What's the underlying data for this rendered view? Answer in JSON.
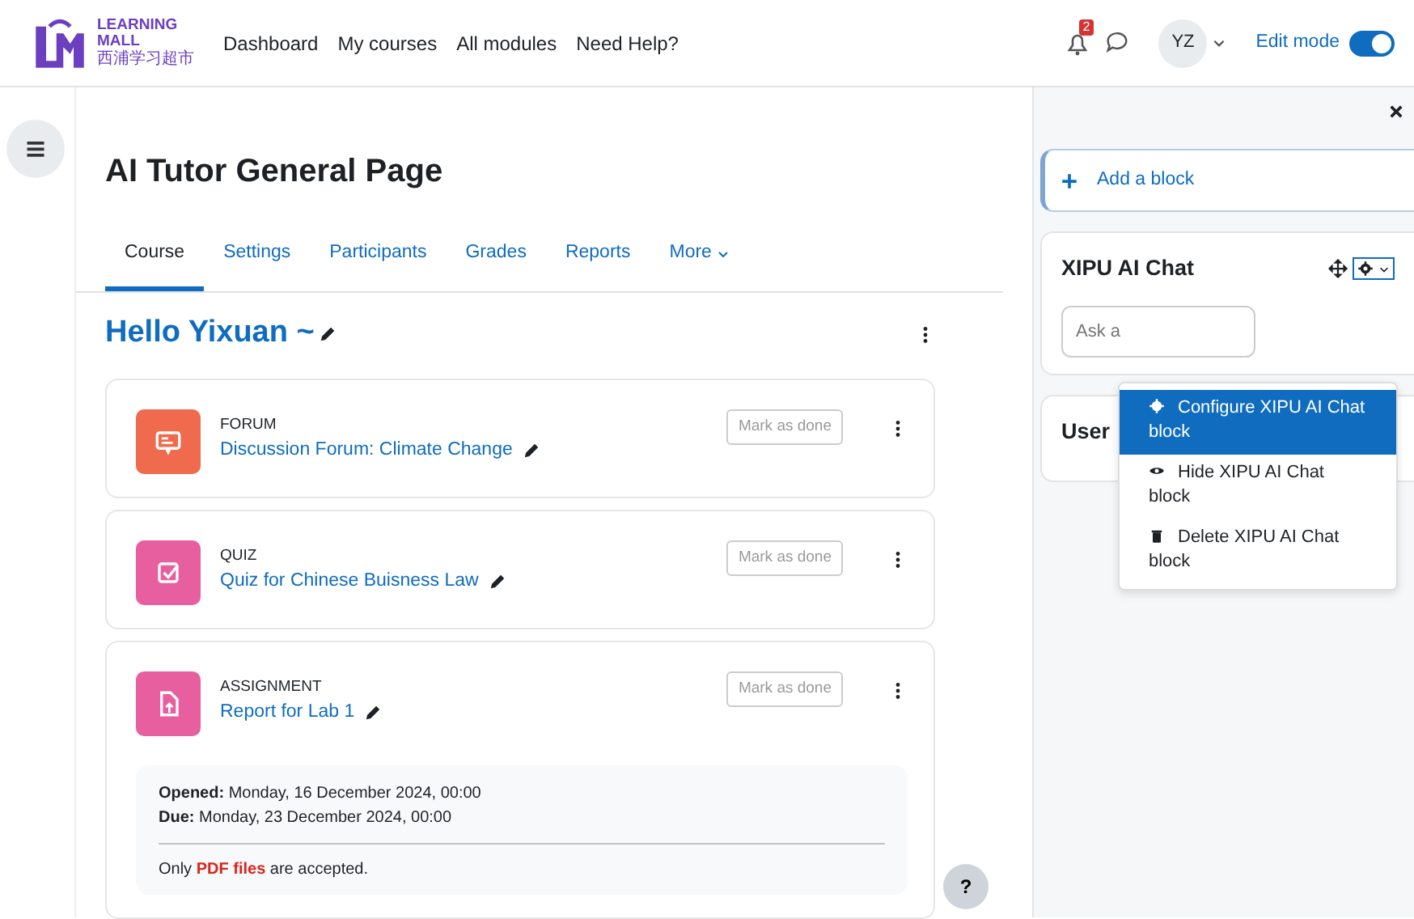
{
  "logo": {
    "lines": [
      "LEARNING",
      "MALL",
      "西浦学习超市"
    ]
  },
  "nav": [
    {
      "label": "Dashboard"
    },
    {
      "label": "My courses"
    },
    {
      "label": "All modules"
    },
    {
      "label": "Need Help?"
    }
  ],
  "notifications": {
    "count": "2"
  },
  "user": {
    "initials": "YZ"
  },
  "edit_mode": {
    "label": "Edit mode",
    "on": true
  },
  "page_title": "AI Tutor General Page",
  "tabs": [
    {
      "label": "Course",
      "selected": true
    },
    {
      "label": "Settings",
      "selected": false
    },
    {
      "label": "Participants",
      "selected": false
    },
    {
      "label": "Grades",
      "selected": false
    },
    {
      "label": "Reports",
      "selected": false
    },
    {
      "label": "More",
      "selected": false,
      "dropdown": true
    }
  ],
  "section_title": "Hello Yixuan ~",
  "activities": [
    {
      "kind": "forum",
      "type_label": "FORUM",
      "name": "Discussion Forum: Climate Change",
      "button": {
        "label": "Mark as done",
        "disabled": true
      }
    },
    {
      "kind": "quiz",
      "type_label": "QUIZ",
      "name": "Quiz for Chinese Buisness Law",
      "button": {
        "label": "Mark as done",
        "disabled": true
      }
    },
    {
      "kind": "assignment",
      "type_label": "ASSIGNMENT",
      "name": "Report for Lab 1",
      "button": {
        "label": "Mark as done",
        "disabled": true
      },
      "details": [
        "**Opened:** Monday, 16 December 2024, 00:00",
        "**Due:** Monday, 23 December 2024, 00:00"
      ],
      "note": {
        "before": "Only ",
        "highlight": "PDF files",
        "after": " are accepted."
      }
    }
  ],
  "help_button": "?",
  "drawer": {
    "add_block": "Add a block",
    "blocks": [
      {
        "kind": "chat",
        "title": "XIPU AI Chat",
        "placeholder": "Ask a"
      },
      {
        "kind": "plain",
        "title": "User"
      }
    ],
    "menu": [
      {
        "kind": "configure",
        "label": "Configure XIPU AI Chat block",
        "selected": true
      },
      {
        "kind": "hide",
        "label": "Hide XIPU AI Chat block",
        "selected": false
      },
      {
        "kind": "delete",
        "label": "Delete XIPU AI Chat block",
        "selected": false
      }
    ]
  }
}
